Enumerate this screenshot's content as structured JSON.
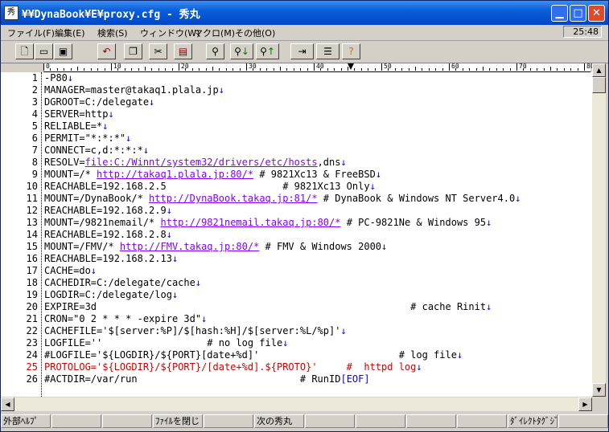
{
  "window": {
    "title": "¥¥DynaBook¥E¥proxy.cfg - 秀丸",
    "app_icon": "秀",
    "minimize_icon": "minimize-icon",
    "maximize_icon": "maximize-icon",
    "close_icon": "close-icon"
  },
  "menu": {
    "items": [
      "ファイル(F)",
      "編集(E)",
      "検索(S)",
      "ウィンドウ(W)",
      "マクロ(M)",
      "その他(O)"
    ],
    "clock": "25:48"
  },
  "toolbar": {
    "tools": [
      "new-file-icon",
      "open-file-icon",
      "save-icon",
      "undo-icon",
      "copy-icon",
      "cut-icon",
      "paste-icon",
      "find-icon",
      "find-next-down-icon",
      "find-next-up-icon",
      "tag-jump-icon",
      "split-window-icon",
      "help-icon"
    ]
  },
  "ruler": {
    "marks": [
      "0",
      "10",
      "20",
      "30",
      "40",
      "50",
      "60",
      "70",
      "80"
    ]
  },
  "editor": {
    "lines": [
      {
        "n": "1",
        "text": "-P80"
      },
      {
        "n": "2",
        "text": "MANAGER=master@takaq1.plala.jp"
      },
      {
        "n": "3",
        "text": "DGROOT=C:/delegate"
      },
      {
        "n": "4",
        "text": "SERVER=http"
      },
      {
        "n": "5",
        "text": "RELIABLE=*"
      },
      {
        "n": "6",
        "text": "PERMIT=\"*:*:*\""
      },
      {
        "n": "7",
        "text": "CONNECT=c,d:*:*:*"
      },
      {
        "n": "8",
        "text": "RESOLV=",
        "url": "file:C:/Winnt/system32/drivers/etc/hosts",
        "after": ",dns"
      },
      {
        "n": "9",
        "text": "MOUNT=/* ",
        "url": "http://takaq1.plala.jp:80/*",
        "after": " # 9821Xc13 & FreeBSD"
      },
      {
        "n": "10",
        "text": "REACHABLE=192.168.2.5                    # 9821Xc13 Only"
      },
      {
        "n": "11",
        "text": "MOUNT=/DynaBook/* ",
        "url": "http://DynaBook.takaq.jp:81/*",
        "after": " # DynaBook & Windows NT Server4.0"
      },
      {
        "n": "12",
        "text": "REACHABLE=192.168.2.9"
      },
      {
        "n": "13",
        "text": "MOUNT=/9821nemail/* ",
        "url": "http://9821nemail.takaq.jp:80/*",
        "after": " # PC-9821Ne & Windows 95"
      },
      {
        "n": "14",
        "text": "REACHABLE=192.168.2.8"
      },
      {
        "n": "15",
        "text": "MOUNT=/FMV/* ",
        "url": "http://FMV.takaq.jp:80/*",
        "after": " # FMV & Windows 2000"
      },
      {
        "n": "16",
        "text": "REACHABLE=192.168.2.13"
      },
      {
        "n": "17",
        "text": "CACHE=do"
      },
      {
        "n": "18",
        "text": "CACHEDIR=C:/delegate/cache"
      },
      {
        "n": "19",
        "text": "LOGDIR=C:/delegate/log"
      },
      {
        "n": "20",
        "text": "EXPIRE=3d                                                      # cache Rinit"
      },
      {
        "n": "21",
        "text": "CRON=\"0 2 * * * -expire 3d\""
      },
      {
        "n": "22",
        "text": "CACHEFILE='$[server:%P]/$[hash:%H]/$[server:%L/%p]'"
      },
      {
        "n": "23",
        "text": "LOGFILE=''                  # no log file"
      },
      {
        "n": "24",
        "text": "#LOGFILE='${LOGDIR}/${PORT}[date+%d]'                        # log file"
      },
      {
        "n": "25",
        "text": "PROTOLOG='${LOGDIR}/${PORT}/[date+%d].${PROTO}'     #  httpd log",
        "highlight": true
      },
      {
        "n": "26",
        "text": "#ACTDIR=/var/run                            # RunID",
        "eof": "[EOF]"
      }
    ],
    "return_mark": "↓"
  },
  "status": {
    "cells": [
      "外部ﾍﾙﾌﾟ",
      "",
      "",
      "ﾌｧｲﾙを閉じ",
      "",
      "次の秀丸",
      "",
      "",
      "",
      "",
      "ﾀﾞｲﾚｸﾄﾀｸﾞｼﾞ",
      ""
    ]
  }
}
